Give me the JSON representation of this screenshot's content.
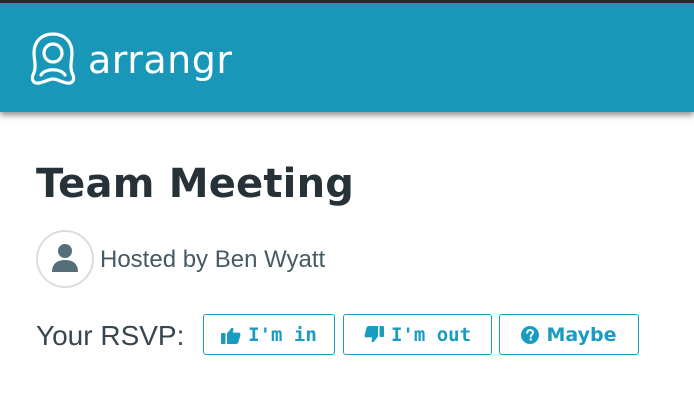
{
  "header": {
    "brand_name": "arrangr",
    "logo_icon": "arrangr-logo-icon",
    "background_color": "#1897b8"
  },
  "event": {
    "title": "Team Meeting",
    "host_text": "Hosted by Ben Wyatt",
    "host_avatar_icon": "user-avatar-icon"
  },
  "rsvp": {
    "label": "Your RSVP:",
    "accent_color": "#1a9bc2",
    "options": [
      {
        "label": "I'm in",
        "icon": "thumbs-up-icon"
      },
      {
        "label": "I'm out",
        "icon": "thumbs-down-icon"
      },
      {
        "label": "Maybe",
        "icon": "question-circle-icon"
      }
    ]
  }
}
